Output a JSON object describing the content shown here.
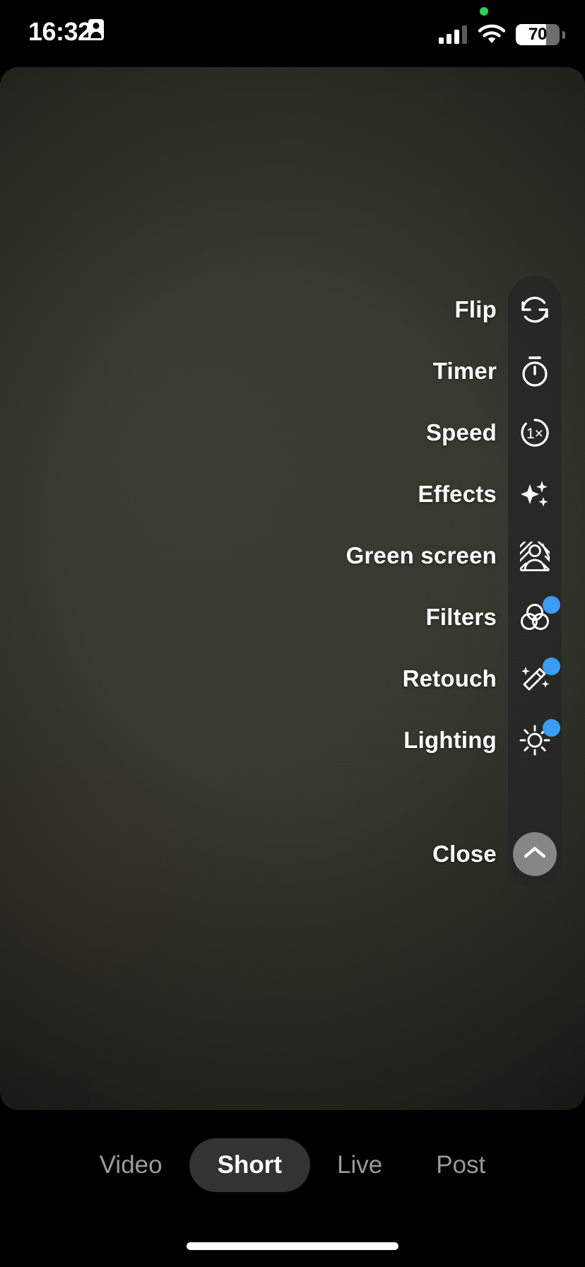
{
  "status_bar": {
    "time": "16:32",
    "badge_icon": "id-card-icon",
    "privacy_indicator": "green-recording-dot",
    "signal_icon": "cellular-signal-icon",
    "wifi_icon": "wifi-icon",
    "battery_level": "70",
    "battery_percent": 70
  },
  "camera": {
    "preview_label": "camera-preview",
    "tint_hex": "#35362c"
  },
  "tool_menu": {
    "accent_hex": "#3b9cf5",
    "rail_hex": "#262626",
    "items": [
      {
        "label": "Flip",
        "icon": "flip-camera-icon",
        "badge": false
      },
      {
        "label": "Timer",
        "icon": "timer-icon",
        "badge": false
      },
      {
        "label": "Speed",
        "icon": "speed-1x-icon",
        "badge": false,
        "icon_text": "1×"
      },
      {
        "label": "Effects",
        "icon": "sparkles-icon",
        "badge": false
      },
      {
        "label": "Green screen",
        "icon": "green-screen-icon",
        "badge": false
      },
      {
        "label": "Filters",
        "icon": "filters-icon",
        "badge": true
      },
      {
        "label": "Retouch",
        "icon": "magic-wand-icon",
        "badge": true
      },
      {
        "label": "Lighting",
        "icon": "sun-lighting-icon",
        "badge": true
      }
    ],
    "close": {
      "label": "Close",
      "icon": "chevron-up-icon"
    }
  },
  "mode_bar": {
    "tabs": [
      {
        "label": "Video",
        "active": false
      },
      {
        "label": "Short",
        "active": true
      },
      {
        "label": "Live",
        "active": false
      },
      {
        "label": "Post",
        "active": false
      }
    ]
  },
  "home_indicator": {
    "label": "home-indicator"
  }
}
